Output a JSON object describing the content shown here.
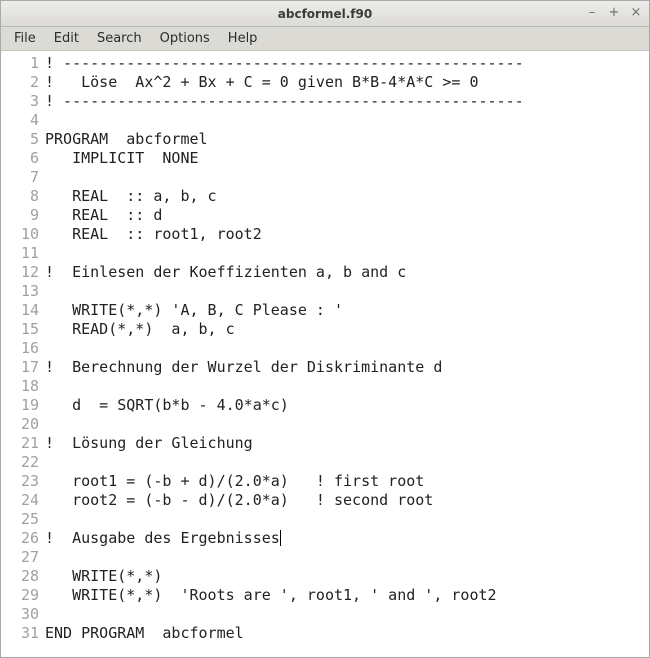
{
  "window": {
    "title": "abcformel.f90",
    "controls": {
      "minimize": "–",
      "maximize": "+",
      "close": "×"
    }
  },
  "menubar": {
    "items": [
      "File",
      "Edit",
      "Search",
      "Options",
      "Help"
    ]
  },
  "editor": {
    "cursor_line": 26,
    "lines": [
      "! ---------------------------------------------------",
      "!   Löse  Ax^2 + Bx + C = 0 given B*B-4*A*C >= 0",
      "! ---------------------------------------------------",
      "",
      "PROGRAM  abcformel",
      "   IMPLICIT  NONE",
      "",
      "   REAL  :: a, b, c",
      "   REAL  :: d",
      "   REAL  :: root1, root2",
      "",
      "!  Einlesen der Koeffizienten a, b and c",
      "",
      "   WRITE(*,*) 'A, B, C Please : '",
      "   READ(*,*)  a, b, c",
      "",
      "!  Berechnung der Wurzel der Diskriminante d",
      "",
      "   d  = SQRT(b*b - 4.0*a*c)",
      "",
      "!  Lösung der Gleichung",
      "",
      "   root1 = (-b + d)/(2.0*a)   ! first root",
      "   root2 = (-b - d)/(2.0*a)   ! second root",
      "",
      "!  Ausgabe des Ergebnisses",
      "",
      "   WRITE(*,*)",
      "   WRITE(*,*)  'Roots are ', root1, ' and ', root2",
      "",
      "END PROGRAM  abcformel"
    ]
  }
}
